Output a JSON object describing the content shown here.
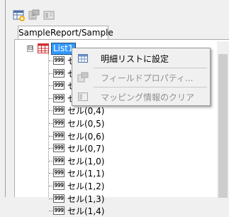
{
  "tab": {
    "label": "SampleReport/Sample"
  },
  "tree": {
    "root": {
      "label": "List1",
      "expander": "⊟"
    },
    "icon_text": "999",
    "items": [
      "セル(0,0)",
      "セル(0,1)",
      "セル(0,2)",
      "セル(0,3)",
      "セル(0,4)",
      "セル(0,5)",
      "セル(0,6)",
      "セル(0,7)",
      "セル(1,0)",
      "セル(1,1)",
      "セル(1,2)",
      "セル(1,3)",
      "セル(1,4)"
    ]
  },
  "context_menu": {
    "items": [
      {
        "label": "明細リストに設定",
        "enabled": true,
        "icon": "table-icon"
      },
      {
        "label": "フィールドプロパティ...",
        "enabled": false,
        "icon": "field-properties-icon"
      },
      {
        "label": "マッピング情報のクリア",
        "enabled": false,
        "icon": "clear-mapping-icon"
      }
    ]
  },
  "colors": {
    "selection": "#3399ff",
    "list_icon": "#d32f2f"
  }
}
